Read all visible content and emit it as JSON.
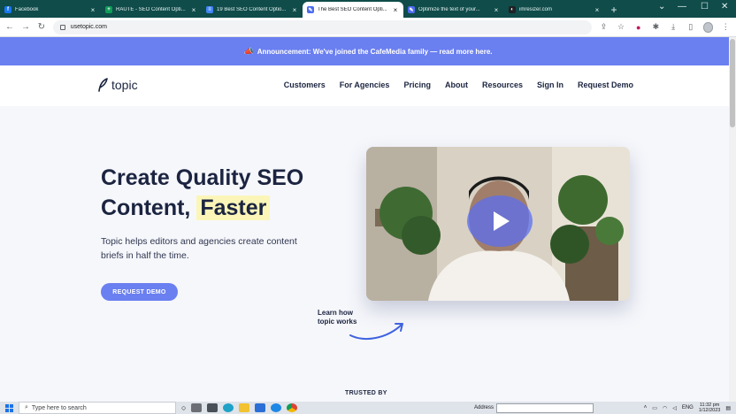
{
  "browser": {
    "tabs": [
      {
        "label": "Facebook",
        "color": "#1877f2",
        "glyph": "f",
        "active": false
      },
      {
        "label": "RAUTE - SEO Content Opti...",
        "color": "#0f9d58",
        "glyph": "+",
        "active": false
      },
      {
        "label": "19 Best SEO Content Optio...",
        "color": "#4285f4",
        "glyph": "≡",
        "active": false
      },
      {
        "label": "The Best SEO Content Opti...",
        "color": "#4d6cf0",
        "glyph": "✎",
        "active": true
      },
      {
        "label": "Optimize the text of your...",
        "color": "#4d6cf0",
        "glyph": "✎",
        "active": false
      },
      {
        "label": "imresizer.com",
        "color": "#202124",
        "glyph": "◐",
        "active": false
      }
    ],
    "url": "usetopic.com"
  },
  "announcement": {
    "text": "Announcement: We've joined the CafeMedia family — read more here."
  },
  "site": {
    "logo_text": "topic",
    "menu": [
      "Customers",
      "For Agencies",
      "Pricing",
      "About",
      "Resources",
      "Sign In",
      "Request Demo"
    ]
  },
  "hero": {
    "title_line1": "Create Quality SEO",
    "title_line2": "Content,",
    "title_highlight": "Faster",
    "subtitle": "Topic helps editors and agencies create content briefs in half the time.",
    "cta": "REQUEST DEMO",
    "learn_line1": "Learn how",
    "learn_line2": "topic works",
    "trusted": "TRUSTED BY"
  },
  "taskbar": {
    "search_placeholder": "Type here to search",
    "address_label": "Address",
    "lang": "ENG",
    "time": "11:32 pm",
    "date": "1/12/2023"
  }
}
